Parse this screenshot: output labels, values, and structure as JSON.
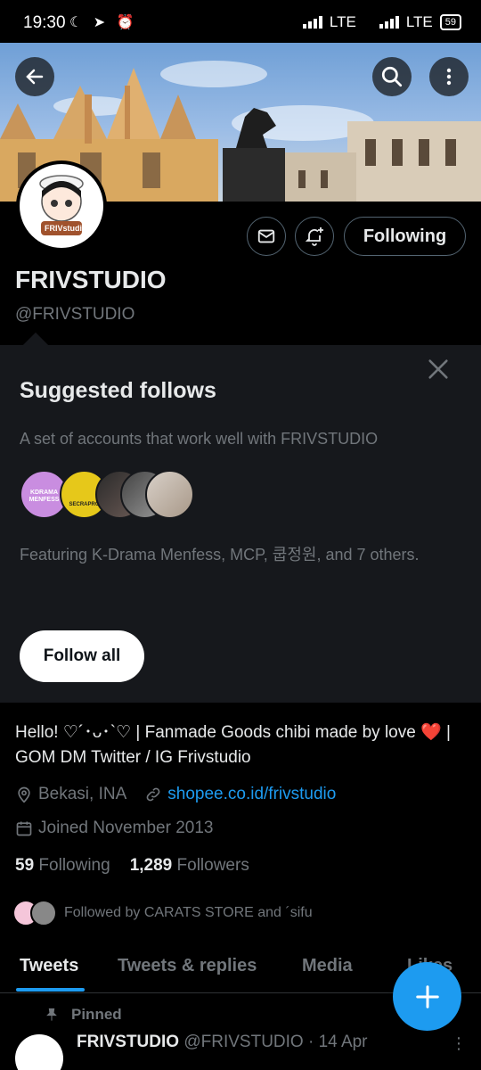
{
  "status_bar": {
    "time": "19:30",
    "network1": "LTE",
    "network2": "LTE",
    "battery": "59"
  },
  "header": {
    "back_icon": "arrow-left-icon",
    "search_icon": "search-icon",
    "more_icon": "more-vertical-icon"
  },
  "profile": {
    "name": "FRIVSTUDIO",
    "handle": "@FRIVSTUDIO",
    "avatar_text": "FRIVstudio",
    "following_button": "Following",
    "bio": "Hello! ♡´･ᴗ･`♡ | Fanmade Goods chibi made by love ❤️ | GOM DM Twitter / IG Frivstudio",
    "location": "Bekasi, INA",
    "website": "shopee.co.id/frivstudio",
    "joined": "Joined November 2013",
    "following_count": "59",
    "following_label": "Following",
    "followers_count": "1,289",
    "followers_label": "Followers",
    "followed_by": "Followed by CARATS STORE and ´sifu"
  },
  "suggested": {
    "title": "Suggested follows",
    "description": "A set of accounts that work well with FRIVSTUDIO",
    "featuring": "Featuring K-Drama Menfess, MCP, 쿱정원, and 7 others.",
    "follow_all": "Follow all",
    "face1_text": "KDRAMA MENFESS",
    "face2_text": "SECRAPRO"
  },
  "tabs": [
    "Tweets",
    "Tweets & replies",
    "Media",
    "Likes"
  ],
  "pinned": {
    "label": "Pinned",
    "author": "FRIVSTUDIO",
    "handle_date": "@FRIVSTUDIO · 14 Apr"
  },
  "colors": {
    "accent": "#1d9bf0",
    "card_bg": "#16181c",
    "muted": "#71767b"
  }
}
